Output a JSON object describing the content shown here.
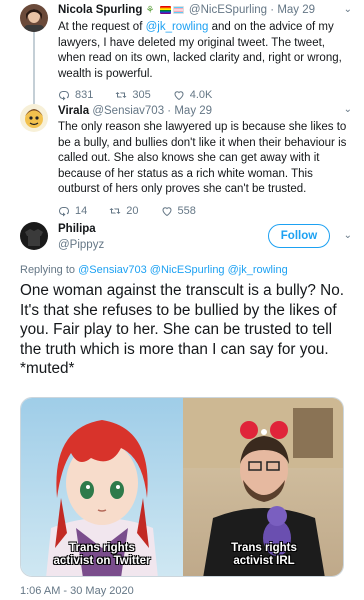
{
  "tweet1": {
    "name": "Nicola Spurling",
    "name_emoji": "⚘",
    "handle": "@NicESpurling",
    "date": "May 29",
    "text_a": "At the request of ",
    "mention": "@jk_rowling",
    "text_b": " and on the advice of my lawyers, I have deleted my original tweet. The tweet, when read on its own, lacked clarity and, right or wrong, wealth is powerful.",
    "replies": "831",
    "retweets": "305",
    "likes": "4.0K",
    "flag_colors": [
      "#e40303",
      "#5bcefa"
    ]
  },
  "tweet2": {
    "name": "Virala",
    "handle": "@Sensiav703",
    "date": "May 29",
    "text": "The only reason she lawyered up is because she likes to be a bully, and bullies don't like it when their behaviour is called out. She also knows she can get away with it because of her status as a rich white woman. This outburst of hers only proves she can't be trusted.",
    "replies": "14",
    "retweets": "20",
    "likes": "558"
  },
  "tweet3": {
    "name": "Philipa",
    "handle": "@Pippyz",
    "follow_label": "Follow",
    "replying_prefix": "Replying to ",
    "replying_to": "@Sensiav703 @NicESpurling @jk_rowling",
    "text": "One woman against the transcult is a bully? No. It's that she refuses to be bullied by the likes of you. Fair play to her. She can be trusted to tell the truth which is more than I can say for you.\n*muted*",
    "meme_left_caption": "Trans rights\nactivist on Twitter",
    "meme_right_caption": "Trans rights\nactivist IRL",
    "timestamp": "1:06 AM - 30 May 2020"
  },
  "separator": " · ",
  "colors": {
    "accent": "#1da1f2",
    "muted": "#657786",
    "text": "#14171a"
  },
  "icons": {
    "reply": "reply-icon",
    "retweet": "retweet-icon",
    "like": "heart-icon",
    "chevron": "chevron-down-icon"
  }
}
